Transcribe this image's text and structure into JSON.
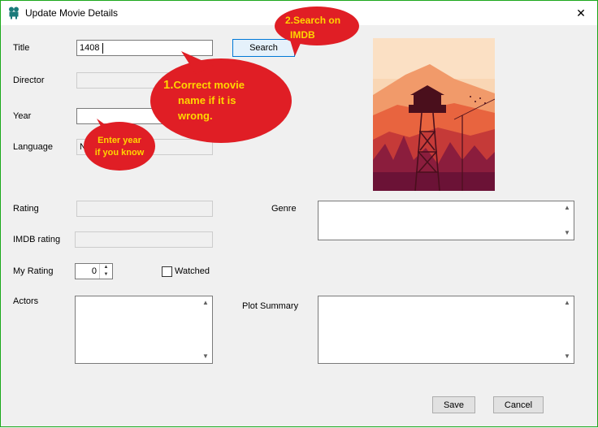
{
  "window": {
    "title": "Update Movie Details",
    "close_glyph": "✕"
  },
  "form": {
    "title_label": "Title",
    "title_value": "1408",
    "search_button": "Search",
    "director_label": "Director",
    "year_label": "Year",
    "language_label": "Language",
    "language_value_partial": "N",
    "rating_label": "Rating",
    "imdb_rating_label": "IMDB rating",
    "my_rating_label": "My Rating",
    "my_rating_value": "0",
    "watched_label": "Watched",
    "actors_label": "Actors",
    "genre_label": "Genre",
    "plot_summary_label": "Plot Summary",
    "save_button": "Save",
    "cancel_button": "Cancel"
  },
  "callouts": {
    "search_hint_line1": "2.Search on",
    "search_hint_line2": "IMDB",
    "correct_hint_num": "1.",
    "correct_hint_line1": "Correct movie",
    "correct_hint_line2": "name if it is",
    "correct_hint_line3": "wrong.",
    "year_hint_line1": "Enter year",
    "year_hint_line2": "if you know"
  },
  "colors": {
    "callout_red": "#e01e25",
    "callout_text": "#ffd600",
    "window_border": "#1ba81b"
  }
}
